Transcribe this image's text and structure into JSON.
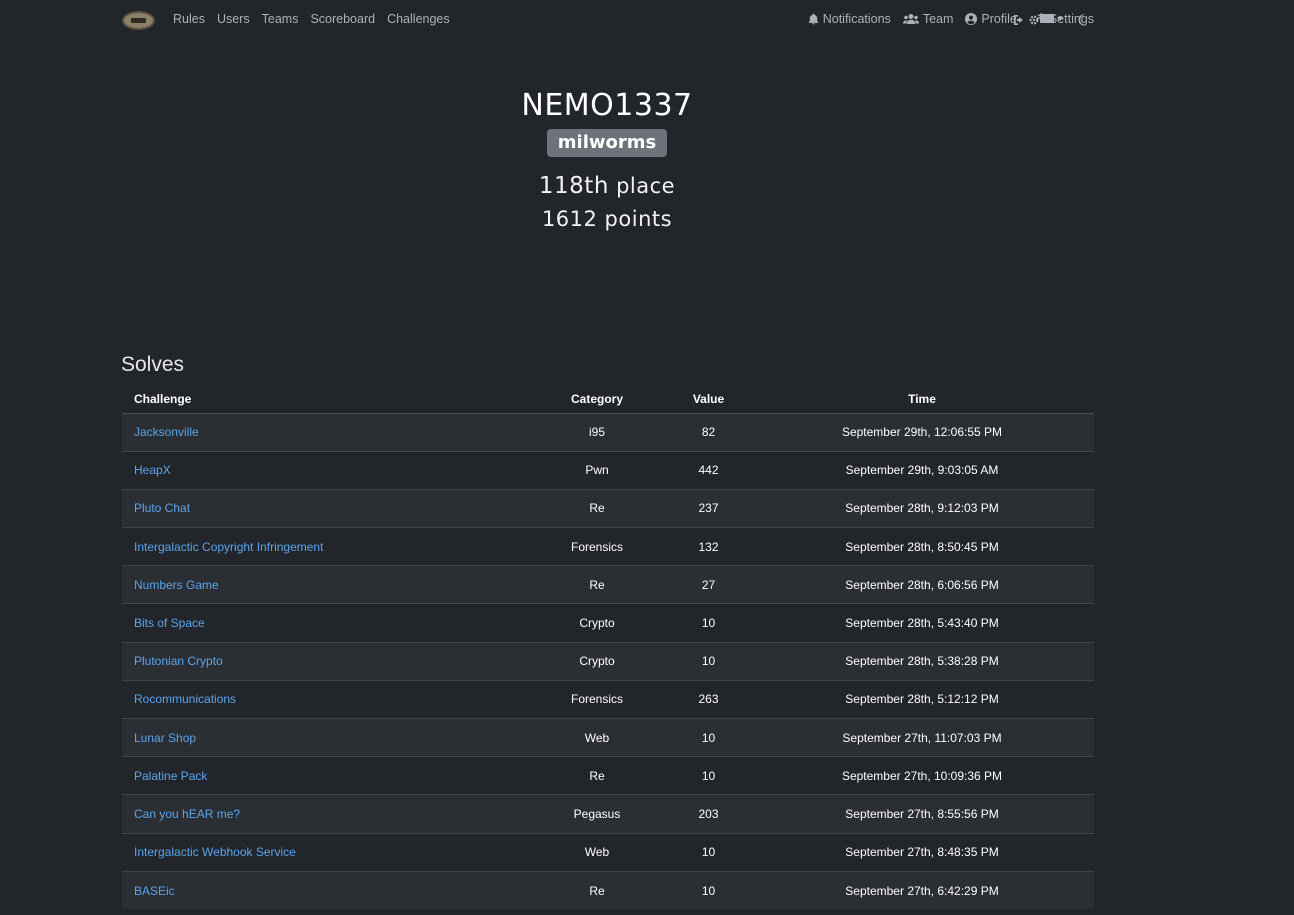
{
  "nav": {
    "left": [
      "Rules",
      "Users",
      "Teams",
      "Scoreboard",
      "Challenges"
    ],
    "right": {
      "notifications": "Notifications",
      "team": "Team",
      "profile": "Profile",
      "settings": "Settings"
    }
  },
  "profile": {
    "name": "NEMO1337",
    "team": "milworms",
    "place_num": "118th",
    "place_label": "place",
    "points": "1612 points"
  },
  "solves": {
    "title": "Solves",
    "columns": [
      "Challenge",
      "Category",
      "Value",
      "Time"
    ],
    "rows": [
      {
        "challenge": "Jacksonville",
        "category": "i95",
        "value": "82",
        "time": "September 29th, 12:06:55 PM"
      },
      {
        "challenge": "HeapX",
        "category": "Pwn",
        "value": "442",
        "time": "September 29th, 9:03:05 AM"
      },
      {
        "challenge": "Pluto Chat",
        "category": "Re",
        "value": "237",
        "time": "September 28th, 9:12:03 PM"
      },
      {
        "challenge": "Intergalactic Copyright Infringement",
        "category": "Forensics",
        "value": "132",
        "time": "September 28th, 8:50:45 PM"
      },
      {
        "challenge": "Numbers Game",
        "category": "Re",
        "value": "27",
        "time": "September 28th, 6:06:56 PM"
      },
      {
        "challenge": "Bits of Space",
        "category": "Crypto",
        "value": "10",
        "time": "September 28th, 5:43:40 PM"
      },
      {
        "challenge": "Plutonian Crypto",
        "category": "Crypto",
        "value": "10",
        "time": "September 28th, 5:38:28 PM"
      },
      {
        "challenge": "Rocommunications",
        "category": "Forensics",
        "value": "263",
        "time": "September 28th, 5:12:12 PM"
      },
      {
        "challenge": "Lunar Shop",
        "category": "Web",
        "value": "10",
        "time": "September 27th, 11:07:03 PM"
      },
      {
        "challenge": "Palatine Pack",
        "category": "Re",
        "value": "10",
        "time": "September 27th, 10:09:36 PM"
      },
      {
        "challenge": "Can you hEAR me?",
        "category": "Pegasus",
        "value": "203",
        "time": "September 27th, 8:55:56 PM"
      },
      {
        "challenge": "Intergalactic Webhook Service",
        "category": "Web",
        "value": "10",
        "time": "September 27th, 8:48:35 PM"
      },
      {
        "challenge": "BASEic",
        "category": "Re",
        "value": "10",
        "time": "September 27th, 6:42:29 PM"
      }
    ]
  },
  "colors": {
    "background": "#22252a",
    "row_alt": "#2b2e33",
    "link": "#5aa5ee",
    "badge": "#6c737b"
  },
  "icons": [
    "logo",
    "bell-icon",
    "users-icon",
    "user-circle-icon",
    "cogs-icon",
    "logout-icon",
    "language-icon",
    "moon-icon"
  ]
}
